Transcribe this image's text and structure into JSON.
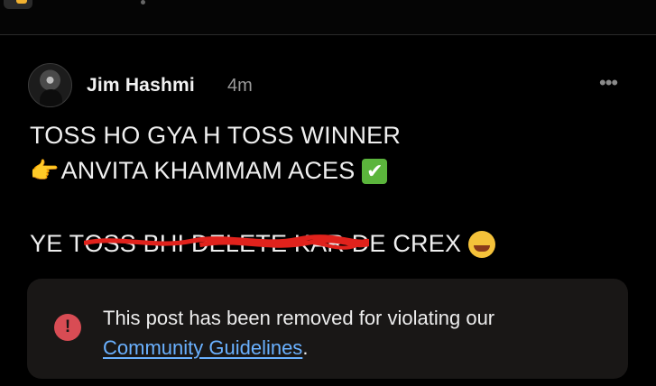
{
  "post": {
    "author": "Jim Hashmi",
    "time": "4m",
    "more_glyph": "•••",
    "line1": "TOSS HO GYA H  TOSS WINNER",
    "line2_emoji": "👉",
    "line2_text": "ANVITA KHAMMAM ACES",
    "line2_check": "✔",
    "line3_prefix": "YE T",
    "line3_redacted": "OSS BHI DELETE KAR D",
    "line3_suffix": "E CREX"
  },
  "notice": {
    "icon_glyph": "!",
    "text": "This post has been removed for violating our",
    "link": "Community Guidelines",
    "suffix": "."
  },
  "icons": {
    "more": "more-options-icon",
    "alert": "alert-icon",
    "avatar": "avatar",
    "laugh": "laughing-emoji-icon",
    "check": "check-mark-icon"
  },
  "colors": {
    "background": "#000000",
    "card": "#191716",
    "link": "#6ab1ff",
    "alert": "#d84c54",
    "redaction": "#e0221c"
  }
}
